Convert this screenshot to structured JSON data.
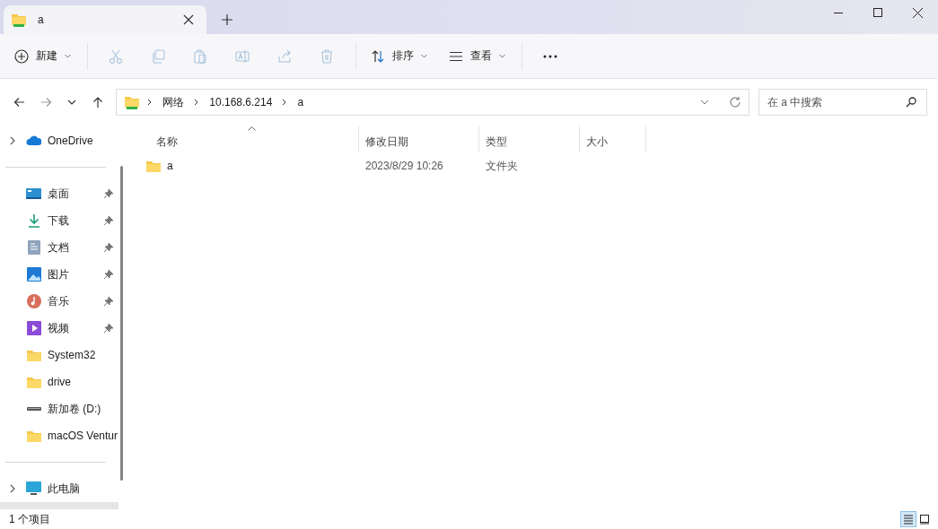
{
  "window": {
    "tab_title": "a"
  },
  "toolbar": {
    "new": {
      "label": "新建"
    },
    "actions": [
      {
        "disabled": true
      },
      {
        "disabled": true
      },
      {
        "disabled": true
      },
      {
        "disabled": true
      },
      {
        "disabled": true
      },
      {
        "disabled": true
      }
    ],
    "sort": {
      "label": "排序"
    },
    "view": {
      "label": "查看"
    }
  },
  "address": {
    "crumbs": [
      "网络",
      "10.168.6.214",
      "a"
    ],
    "search_placeholder": "在 a 中搜索"
  },
  "sidebar": {
    "sections": [
      {
        "items": [
          {
            "label": "OneDrive",
            "expanded": false,
            "selected": false
          }
        ]
      },
      {
        "items": [
          {
            "label": "桌面",
            "pinned": true,
            "selected": false
          },
          {
            "label": "下载",
            "pinned": true,
            "selected": false
          },
          {
            "label": "文档",
            "pinned": true,
            "selected": false
          },
          {
            "label": "图片",
            "pinned": true,
            "selected": false
          },
          {
            "label": "音乐",
            "pinned": true,
            "selected": false
          },
          {
            "label": "视频",
            "pinned": true,
            "selected": false
          },
          {
            "label": "System32",
            "pinned": false,
            "selected": false
          },
          {
            "label": "drive",
            "pinned": false,
            "selected": false
          },
          {
            "label": "新加卷 (D:)",
            "pinned": false,
            "selected": false
          },
          {
            "label": "macOS Ventur",
            "pinned": false,
            "selected": false
          }
        ]
      },
      {
        "items": [
          {
            "label": "此电脑",
            "expanded": false,
            "selected": false
          },
          {
            "selected": true
          }
        ]
      }
    ]
  },
  "file_list": {
    "columns": [
      {
        "label": "名称",
        "sorted": true
      },
      {
        "label": "修改日期",
        "sorted": false
      },
      {
        "label": "类型",
        "sorted": false
      },
      {
        "label": "大小",
        "sorted": false
      }
    ],
    "rows": [
      {
        "name": "a",
        "modified": "2023/8/29 10:26",
        "type": "文件夹"
      }
    ]
  },
  "status_bar": {
    "count": "1 个项目",
    "views": [
      {
        "selected": true
      },
      {
        "selected": false
      }
    ]
  }
}
